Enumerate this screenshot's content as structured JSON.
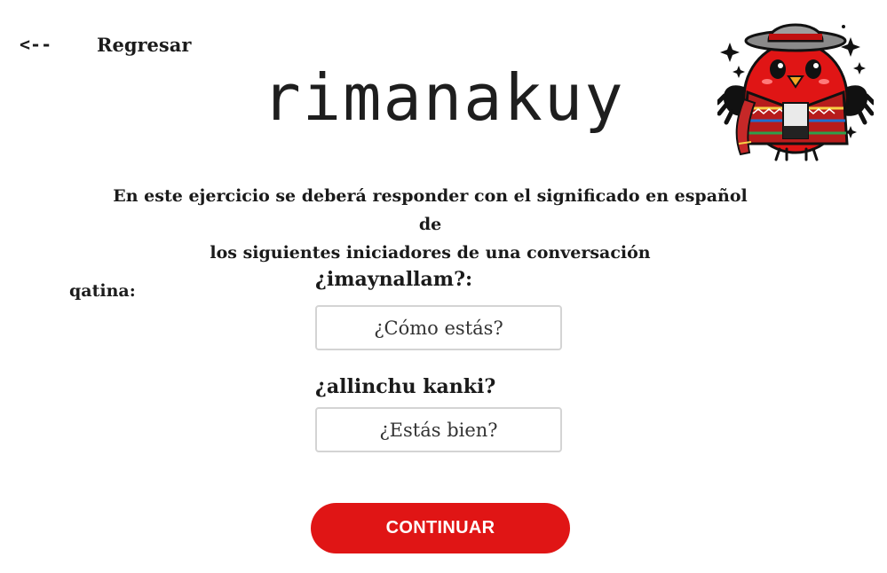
{
  "nav": {
    "back_arrow": "<--",
    "back_label": "Regresar"
  },
  "header": {
    "title": "rimanakuy",
    "mascot_icon": "bird-mascot-icon"
  },
  "instructions": {
    "line1": "En este ejercicio se deberá responder con el significado en español de",
    "line2": "los siguientes iniciadores de una conversación"
  },
  "exercise": {
    "section_label": "qatina:",
    "items": [
      {
        "question": "¿imaynallam?:",
        "answer": "¿Cómo estás?"
      },
      {
        "question": "¿allinchu kanki?",
        "answer": "¿Estás bien?"
      }
    ]
  },
  "actions": {
    "continue_label": "CONTINUAR"
  },
  "colors": {
    "accent": "#e01515",
    "text": "#1c1c1c",
    "field_border": "#d4d4d4"
  }
}
